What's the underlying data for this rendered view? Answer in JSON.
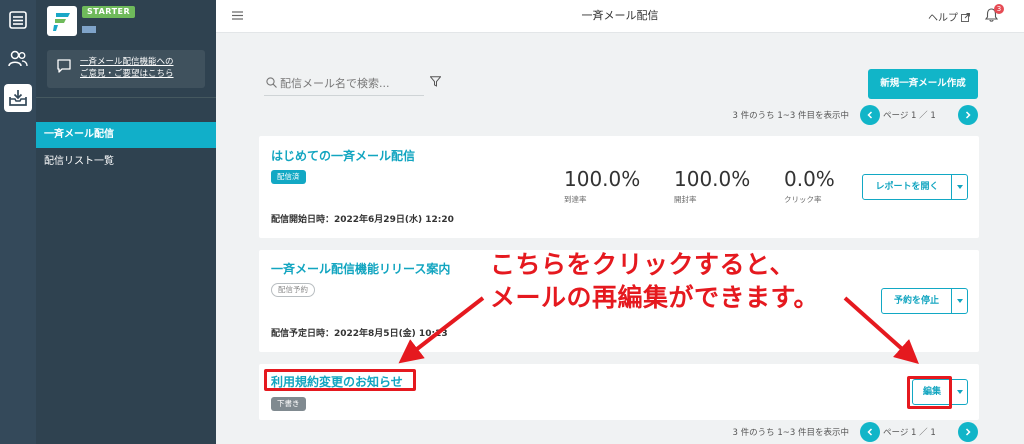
{
  "rail": {
    "items": [
      {
        "icon": "dashboard-icon"
      },
      {
        "icon": "contacts-icon"
      },
      {
        "icon": "mail-inbox-icon"
      }
    ]
  },
  "sidebar": {
    "plan_badge": "STARTER",
    "feedback_text": "一斉メール配信機能への\nご意見・ご要望はこちら",
    "nav": [
      {
        "label": "一斉メール配信",
        "active": true
      },
      {
        "label": "配信リスト一覧",
        "active": false
      }
    ]
  },
  "header": {
    "title": "一斉メール配信",
    "help_label": "ヘルプ",
    "notification_count": "3"
  },
  "toolbar": {
    "search_placeholder": "配信メール名で検索...",
    "create_label": "新規一斉メール作成"
  },
  "pagination": {
    "count_text": "3 件のうち 1~3 件目を表示中",
    "page_text": "ページ 1 ／ 1"
  },
  "mails": [
    {
      "title": "はじめての一斉メール配信",
      "status": "配信済",
      "date_text": "配信開始日時：2022年6月29日(水) 12:20",
      "metrics": [
        {
          "value": "100.0%",
          "label": "到達率"
        },
        {
          "value": "100.0%",
          "label": "開封率"
        },
        {
          "value": "0.0%",
          "label": "クリック率"
        }
      ],
      "action_label": "レポートを開く"
    },
    {
      "title": "一斉メール配信機能リリース案内",
      "status": "配信予約",
      "date_text": "配信予定日時：2022年8月5日(金) 10:13",
      "action_label": "予約を停止"
    },
    {
      "title": "利用規約変更のお知らせ",
      "status": "下書き",
      "action_label": "編集"
    }
  ],
  "annotation": {
    "text": "こちらをクリックすると、\nメールの再編集ができます。",
    "color": "#e5191f"
  },
  "colors": {
    "accent": "#11b5c8",
    "sidebar_bg": "#2f4250",
    "rail_bg": "#34495a"
  }
}
